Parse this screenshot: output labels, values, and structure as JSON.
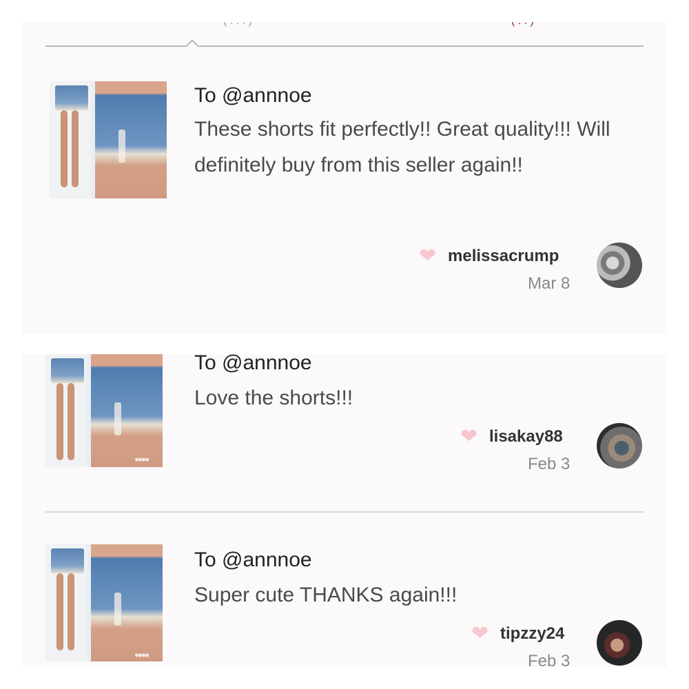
{
  "tabs_fragment": [
    "( . . . )",
    "( . . )"
  ],
  "reviews": [
    {
      "title": "To @annnoe",
      "text": "These shorts fit perfectly!! Great quality!!! Will definitely buy from this seller again!!",
      "user": "melissacrump",
      "date": "Mar 8",
      "image_icon": "denim-shorts-thumbnail",
      "heart_icon": "heart-icon"
    },
    {
      "title": "To @annnoe",
      "text": "Love the shorts!!!",
      "user": "lisakay88",
      "date": "Feb 3",
      "image_icon": "denim-shorts-thumbnail",
      "heart_icon": "heart-icon"
    },
    {
      "title": "To @annnoe",
      "text": "Super cute THANKS again!!!",
      "user": "tipzzy24",
      "date": "Feb 3",
      "image_icon": "denim-shorts-thumbnail",
      "heart_icon": "heart-icon"
    }
  ],
  "colors": {
    "background": "#fbf9fa",
    "heart": "#f7c7cd",
    "accent": "#8b2232"
  }
}
